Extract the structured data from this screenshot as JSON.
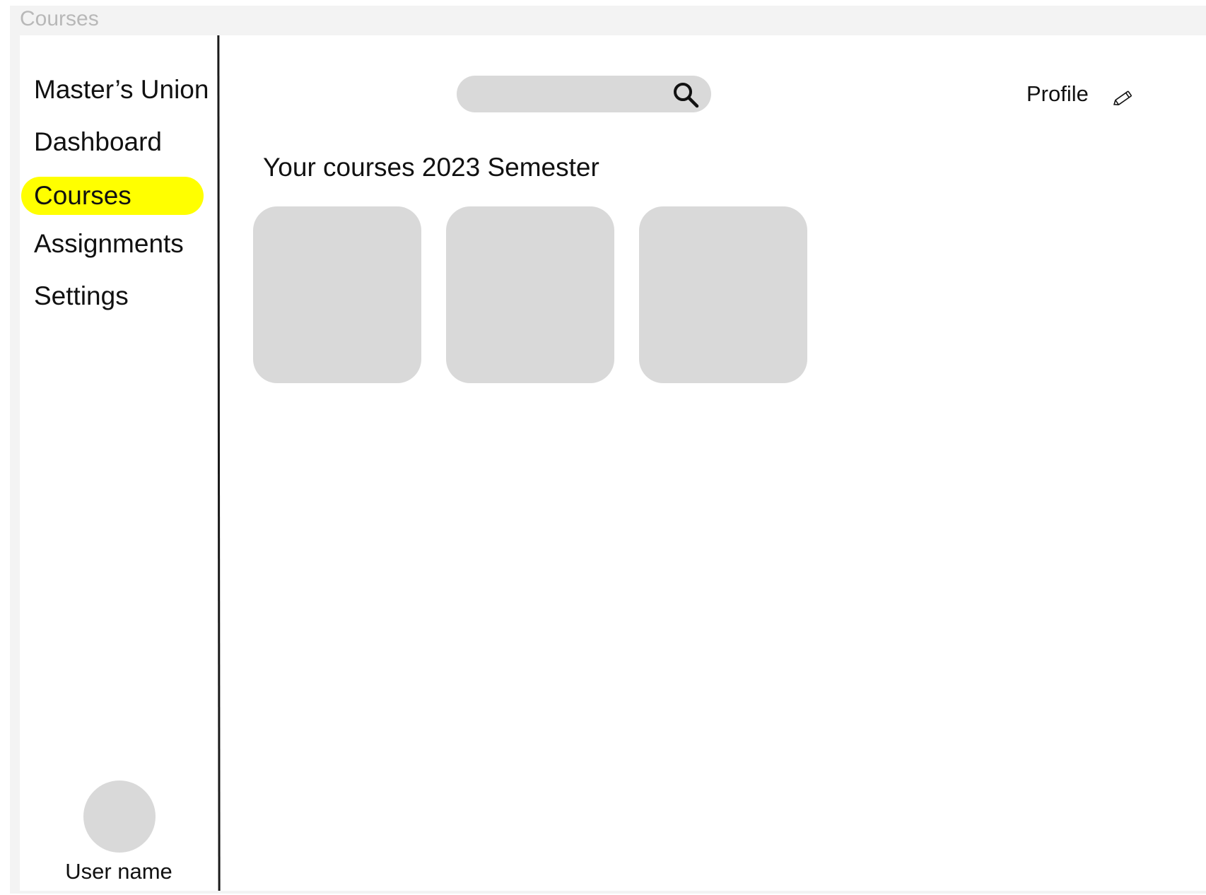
{
  "frame": {
    "label": "Courses"
  },
  "sidebar": {
    "brand": "Master’s Union",
    "items": [
      {
        "label": "Dashboard",
        "active": false
      },
      {
        "label": "Courses",
        "active": true
      },
      {
        "label": "Assignments",
        "active": false
      },
      {
        "label": "Settings",
        "active": false
      }
    ],
    "user": {
      "name": "User name"
    }
  },
  "header": {
    "search": {
      "value": "",
      "placeholder": "",
      "icon": "search-icon"
    },
    "profile": {
      "label": "Profile",
      "icon": "pencil-icon"
    }
  },
  "main": {
    "title": "Your courses 2023 Semester",
    "course_cards": 3
  },
  "colors": {
    "active_highlight": "#ffff00",
    "placeholder_gray": "#d9d9d9",
    "text": "#111111",
    "frame_label": "#b8b8b8"
  }
}
